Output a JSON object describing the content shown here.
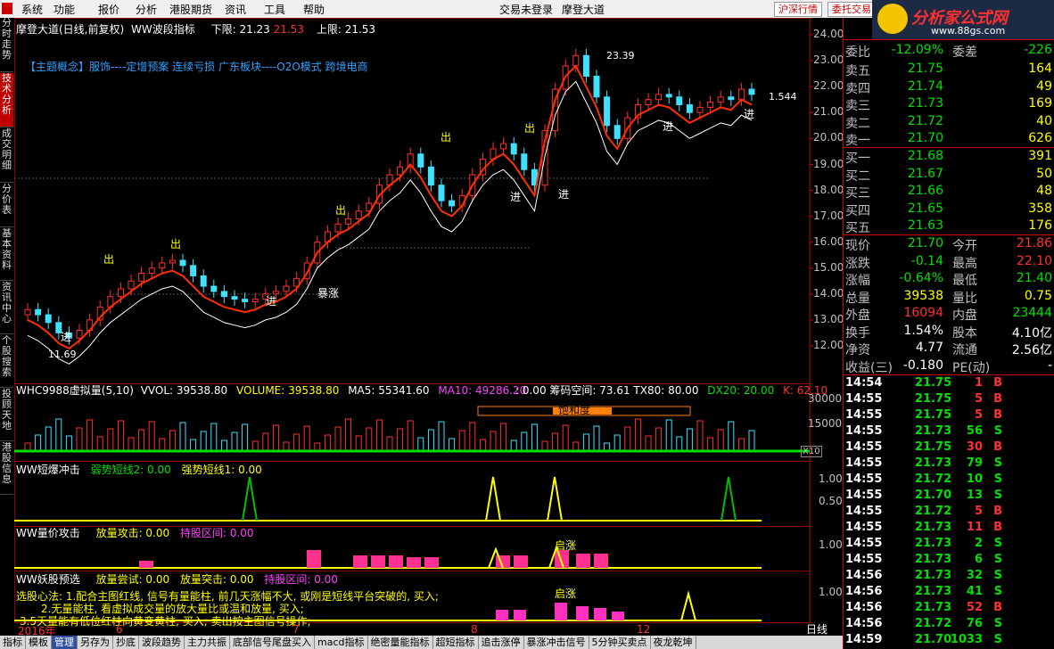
{
  "menu": {
    "items": [
      "系统",
      "功能",
      "报价",
      "分析",
      "港股期货",
      "资讯",
      "工具",
      "帮助"
    ],
    "status": "交易未登录",
    "center_title": "摩登大道",
    "btn1": "沪深行情",
    "btn2": "委托交易"
  },
  "brand": {
    "name": "分析家公式网",
    "url": "www.88gs.com"
  },
  "left_tabs": [
    "分时走势",
    "技术分析",
    "成交明细",
    "分价表",
    "基本资料",
    "资讯中心",
    "个股搜索",
    "投顾天地",
    "港股信息"
  ],
  "chart": {
    "title_name": "摩登大道(日线,前复权)",
    "indicator": "WW波段指标",
    "low_label": "下限:",
    "low_val": "21.23",
    "mid_val": "21.53",
    "high_label": "上限:",
    "high_val": "21.53",
    "concept": "【主题概念】服饰----定增预案 连续亏损 广东板块----O2O模式 跨境电商",
    "price_ticks": [
      "24.00",
      "23.00",
      "22.00",
      "21.00",
      "20.00",
      "19.00",
      "18.00",
      "17.00",
      "16.00",
      "15.00",
      "14.00",
      "13.00",
      "12.00"
    ],
    "max_label": "23.39",
    "min_label": "11.69",
    "last_label": "1.544",
    "marks": {
      "chu": "出",
      "jin": "进",
      "baozhang": "暴涨"
    }
  },
  "volume_panel": {
    "label": "WHC9988虚拟量(5,10)",
    "vol": "VVOL: 39538.80",
    "volume": "VOLUME: 39538.80",
    "ma5": "MA5: 55341.60",
    "ma10": "MA10: 49286.20",
    "extra": ": 0.00  筹码空间: 73.61  TX80: 80.00",
    "dx": "DX20: 20.00",
    "k": "K: 62.10",
    "saturation": "饱和度",
    "ticks": [
      "30000",
      "15000"
    ],
    "x10": "X10"
  },
  "panel2": {
    "label": "WW短爆冲击",
    "a": "弱势短线2: 0.00",
    "b": "强势短线1: 0.00",
    "ticks": [
      "1.00",
      "0.50"
    ]
  },
  "panel3": {
    "label": "WW量价攻击",
    "a": "放量攻击: 0.00",
    "b": "持股区间: 0.00",
    "tick": "1.00",
    "qizhang": "启涨"
  },
  "panel4": {
    "label": "WW妖股预选",
    "a": "放量尝试: 0.00",
    "b": "放量突击: 0.00",
    "c": "持股区间: 0.00",
    "tick": "1.00",
    "qizhang": "启涨",
    "method": [
      "选股心法: 1.配合主图红线, 信号有量能柱, 前几天涨幅不大, 或刚是短线平台突破的, 买入;",
      "2.无量能柱, 看虚拟成交量的放大量比或温和放量, 买入;",
      "3.5天量能有低位红柱向黄变黄柱, 买入; 卖出按主图信号操作;"
    ]
  },
  "xaxis": {
    "labels": [
      "2016年",
      "6",
      "7",
      "8",
      "12"
    ],
    "period": "日线"
  },
  "quote": {
    "weibi": {
      "l": "委比",
      "v": "-12.09%",
      "l2": "委差",
      "v2": "-226"
    },
    "asks": [
      {
        "l": "卖五",
        "p": "21.75",
        "q": "164"
      },
      {
        "l": "卖四",
        "p": "21.74",
        "q": "49"
      },
      {
        "l": "卖三",
        "p": "21.73",
        "q": "169"
      },
      {
        "l": "卖二",
        "p": "21.72",
        "q": "40"
      },
      {
        "l": "卖一",
        "p": "21.70",
        "q": "626"
      }
    ],
    "bids": [
      {
        "l": "买一",
        "p": "21.68",
        "q": "391"
      },
      {
        "l": "买二",
        "p": "21.67",
        "q": "50"
      },
      {
        "l": "买三",
        "p": "21.66",
        "q": "48"
      },
      {
        "l": "买四",
        "p": "21.65",
        "q": "358"
      },
      {
        "l": "买五",
        "p": "21.63",
        "q": "176"
      }
    ],
    "stats": [
      {
        "l": "现价",
        "v": "21.70",
        "vc": "green",
        "l2": "今开",
        "v2": "21.86",
        "v2c": "red"
      },
      {
        "l": "涨跌",
        "v": "-0.14",
        "vc": "green",
        "l2": "最高",
        "v2": "22.10",
        "v2c": "red"
      },
      {
        "l": "涨幅",
        "v": "-0.64%",
        "vc": "green",
        "l2": "最低",
        "v2": "21.40",
        "v2c": "green"
      },
      {
        "l": "总量",
        "v": "39538",
        "vc": "yellow",
        "l2": "量比",
        "v2": "0.75",
        "v2c": "yellow"
      },
      {
        "l": "外盘",
        "v": "16094",
        "vc": "red",
        "l2": "内盘",
        "v2": "23444",
        "v2c": "green"
      },
      {
        "l": "换手",
        "v": "1.54%",
        "vc": "white",
        "l2": "股本",
        "v2": "4.10亿",
        "v2c": "white"
      },
      {
        "l": "净资",
        "v": "4.77",
        "vc": "white",
        "l2": "流通",
        "v2": "2.56亿",
        "v2c": "white"
      },
      {
        "l": "收益(三)",
        "v": "-0.180",
        "vc": "white",
        "l2": "PE(动)",
        "v2": "-",
        "v2c": "white"
      }
    ],
    "ticks": [
      {
        "t": "14:54",
        "p": "21.75",
        "q": "1",
        "d": "B"
      },
      {
        "t": "14:55",
        "p": "21.75",
        "q": "5",
        "d": "B"
      },
      {
        "t": "14:55",
        "p": "21.75",
        "q": "5",
        "d": "B"
      },
      {
        "t": "14:55",
        "p": "21.73",
        "q": "56",
        "d": "S"
      },
      {
        "t": "14:55",
        "p": "21.75",
        "q": "30",
        "d": "B"
      },
      {
        "t": "14:55",
        "p": "21.73",
        "q": "79",
        "d": "S"
      },
      {
        "t": "14:55",
        "p": "21.72",
        "q": "10",
        "d": "S"
      },
      {
        "t": "14:55",
        "p": "21.70",
        "q": "13",
        "d": "S"
      },
      {
        "t": "14:55",
        "p": "21.72",
        "q": "5",
        "d": "B"
      },
      {
        "t": "14:55",
        "p": "21.73",
        "q": "11",
        "d": "B"
      },
      {
        "t": "14:55",
        "p": "21.73",
        "q": "2",
        "d": "S"
      },
      {
        "t": "14:55",
        "p": "21.73",
        "q": "6",
        "d": "S"
      },
      {
        "t": "14:56",
        "p": "21.73",
        "q": "32",
        "d": "S"
      },
      {
        "t": "14:56",
        "p": "21.73",
        "q": "41",
        "d": "S"
      },
      {
        "t": "14:56",
        "p": "21.73",
        "q": "52",
        "d": "B"
      },
      {
        "t": "14:56",
        "p": "21.72",
        "q": "76",
        "d": "S"
      },
      {
        "t": "14:59",
        "p": "21.70",
        "q": "1033",
        "d": "S"
      }
    ]
  },
  "bottom_tabs": [
    "指标",
    "模板",
    "管理",
    "另存为",
    "抄底",
    "波段趋势",
    "主力共振",
    "底部信号尾盘买入",
    "macd指标",
    "绝密量能指标",
    "超短指标",
    "追击涨停",
    "暴涨冲击信号",
    "5分钟买卖点",
    "夜龙乾坤"
  ]
}
